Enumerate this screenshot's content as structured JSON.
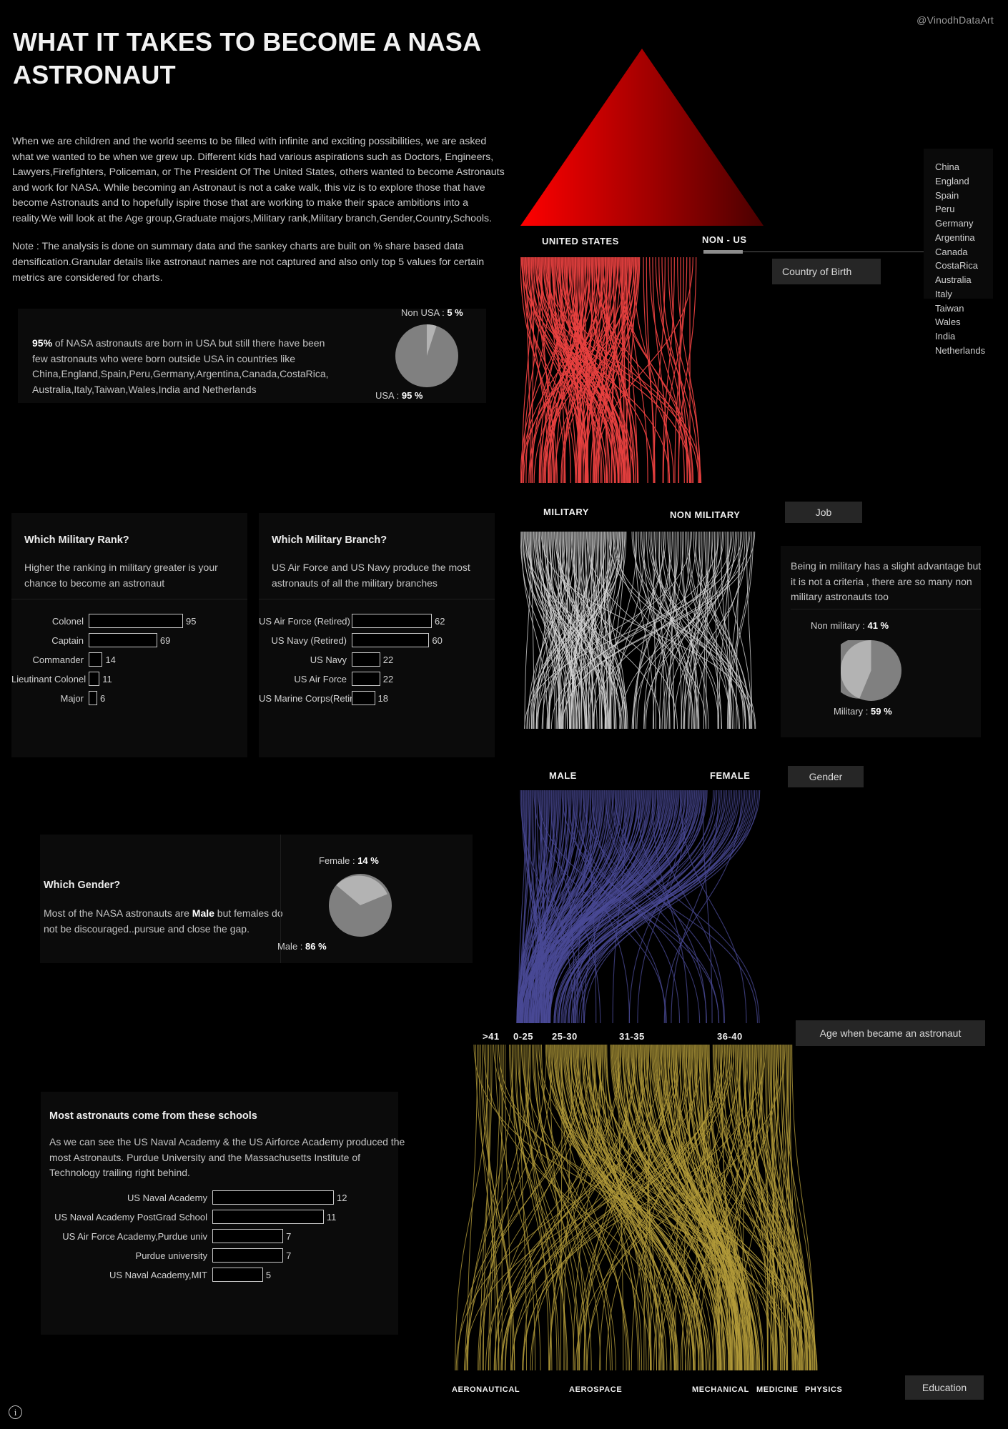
{
  "handle": "@VinodhDataArt",
  "title": "WHAT IT TAKES TO BECOME A NASA ASTRONAUT",
  "intro": {
    "paragraph1": "When we are children and the world seems to be filled with infinite and exciting possibilities, we are asked what we wanted to be when we grew up. Different kids had various aspirations such as Doctors, Engineers, Lawyers,Firefighters, Policeman, or The President Of The United States, others wanted to become Astronauts and work for NASA. While becoming an Astronaut is not a cake walk, this viz is to explore those that have become Astronauts and to hopefully ispire those that are working to make their space ambitions into a reality.We will look at the Age group,Graduate majors,Military rank,Military branch,Gender,Country,Schools.",
    "paragraph2": "Note : The analysis is done on summary data  and the sankey charts are built on % share based data densification.Granular details like astronaut names are not captured and also only top 5 values for certain metrics are considered for charts."
  },
  "country_card": {
    "text_lead": "95%",
    "text_rest": " of NASA astronauts are born in USA but still there have been few astronauts who were born outside USA in countries like China,England,Spain,Peru,Germany,Argentina,Canada,CostaRica, Australia,Italy,Taiwan,Wales,India and Netherlands"
  },
  "country_list": [
    "China",
    "England",
    "Spain",
    "Peru",
    "Germany",
    "Argentina",
    "Canada",
    "CostaRica",
    "Australia",
    "Italy",
    "Taiwan",
    "Wales",
    "India",
    "Netherlands"
  ],
  "buttons": {
    "country_of_birth": "Country of Birth",
    "job": "Job",
    "gender": "Gender",
    "age": "Age when became an astronaut",
    "education": "Education"
  },
  "military_rank": {
    "title": "Which Military Rank?",
    "text": "Higher the ranking in military greater is your chance to become an astronaut"
  },
  "military_branch": {
    "title": "Which Military Branch?",
    "text": "US Air Force and US Navy produce the most astronauts of all the military branches"
  },
  "job_card": {
    "text": "Being in military has a slight advantage but it is not a criteria , there are so many non military astronauts too"
  },
  "gender_card": {
    "title": "Which Gender?",
    "text_a": "Most of the NASA astronauts are ",
    "text_bold": "Male",
    "text_b": " but females do not be discouraged..pursue and close the gap."
  },
  "schools_card": {
    "title": "Most astronauts come from these schools",
    "text": "As we can see the US Naval Academy & the US Airforce Academy produced the most Astronauts. Purdue University and the Massachusetts Institute of Technology trailing right behind."
  },
  "pie_labels": {
    "non_usa": "Non USA : ",
    "non_usa_val": "5 %",
    "usa": "USA : ",
    "usa_val": "95 %",
    "non_military": "Non military : ",
    "non_military_val": "41 %",
    "military": "Military : ",
    "military_val": "59 %",
    "female": "Female : ",
    "female_val": "14 %",
    "male": "Male : ",
    "male_val": "86 %"
  },
  "sankey_labels": {
    "united_states": "UNITED STATES",
    "non_us": "NON - US",
    "military": "MILITARY",
    "non_military": "NON MILITARY",
    "male": "MALE",
    "female": "FEMALE",
    "age_gt41": ">41",
    "age_0_25": "0-25",
    "age_25_30": "25-30",
    "age_31_35": "31-35",
    "age_36_40": "36-40",
    "edu_aeronautical": "AERONAUTICAL",
    "edu_aerospace": "AEROSPACE",
    "edu_mechanical": "MECHANICAL",
    "edu_medicine": "MEDICINE",
    "edu_physics": "PHYSICS"
  },
  "info_glyph": "i",
  "colors": {
    "country_flow": "#e8403f",
    "job_flow": "#d8d8d8",
    "gender_flow": "#4a4a96",
    "education_flow": "#b39b3a",
    "pie_dark": "#808080",
    "pie_light": "#b3b3b3",
    "pill_bg": "#262626",
    "card_bg": "#0b0b0b"
  },
  "chart_data": [
    {
      "type": "bar",
      "title": "Which Military Rank?",
      "orientation": "horizontal",
      "categories": [
        "Colonel",
        "Captain",
        "Commander",
        "Lieutinant Colonel",
        "Major"
      ],
      "values": [
        95,
        69,
        14,
        11,
        6
      ],
      "xlabel": "",
      "ylabel": "",
      "xlim": [
        0,
        95
      ],
      "grid": false
    },
    {
      "type": "bar",
      "title": "Which Military Branch?",
      "orientation": "horizontal",
      "categories": [
        "US Air Force (Retired)",
        "US Navy (Retired)",
        "US Navy",
        "US Air Force",
        "US Marine Corps(Retired)"
      ],
      "values": [
        62,
        60,
        22,
        22,
        18
      ],
      "xlabel": "",
      "ylabel": "",
      "xlim": [
        0,
        62
      ],
      "grid": false
    },
    {
      "type": "bar",
      "title": "Most astronauts come from these schools",
      "orientation": "horizontal",
      "categories": [
        "US Naval Academy",
        "US Naval Academy PostGrad School",
        "US Air Force Academy,Purdue univ",
        "Purdue university",
        "US Naval Academy,MIT"
      ],
      "values": [
        12,
        11,
        7,
        7,
        5
      ],
      "xlabel": "",
      "ylabel": "",
      "xlim": [
        0,
        12
      ],
      "grid": false
    },
    {
      "type": "pie",
      "title": "Country of Birth",
      "categories": [
        "USA",
        "Non USA"
      ],
      "values": [
        95,
        5
      ],
      "unit": "%",
      "legend": "labels outside"
    },
    {
      "type": "pie",
      "title": "Job",
      "categories": [
        "Military",
        "Non military"
      ],
      "values": [
        59,
        41
      ],
      "unit": "%",
      "legend": "labels outside"
    },
    {
      "type": "pie",
      "title": "Gender",
      "categories": [
        "Male",
        "Female"
      ],
      "values": [
        86,
        14
      ],
      "unit": "%",
      "legend": "labels outside"
    },
    {
      "type": "sankey",
      "title": "Country of Birth",
      "categories": [
        "UNITED STATES",
        "NON - US"
      ],
      "values": [
        95,
        5
      ],
      "color": "#e8403f"
    },
    {
      "type": "sankey",
      "title": "Job",
      "categories": [
        "MILITARY",
        "NON MILITARY"
      ],
      "values": [
        59,
        41
      ],
      "color": "#d8d8d8"
    },
    {
      "type": "sankey",
      "title": "Gender",
      "categories": [
        "MALE",
        "FEMALE"
      ],
      "values": [
        86,
        14
      ],
      "color": "#4a4a96"
    },
    {
      "type": "sankey",
      "title": "Age when became an astronaut",
      "categories": [
        ">41",
        "0-25",
        "25-30",
        "31-35",
        "36-40"
      ],
      "values": [
        6,
        8,
        22,
        38,
        26
      ],
      "color": "#b39b3a"
    },
    {
      "type": "sankey",
      "title": "Education",
      "categories": [
        "AERONAUTICAL",
        "AEROSPACE",
        "MECHANICAL",
        "MEDICINE",
        "PHYSICS"
      ],
      "values": [
        30,
        25,
        18,
        14,
        13
      ],
      "color": "#b39b3a"
    }
  ]
}
